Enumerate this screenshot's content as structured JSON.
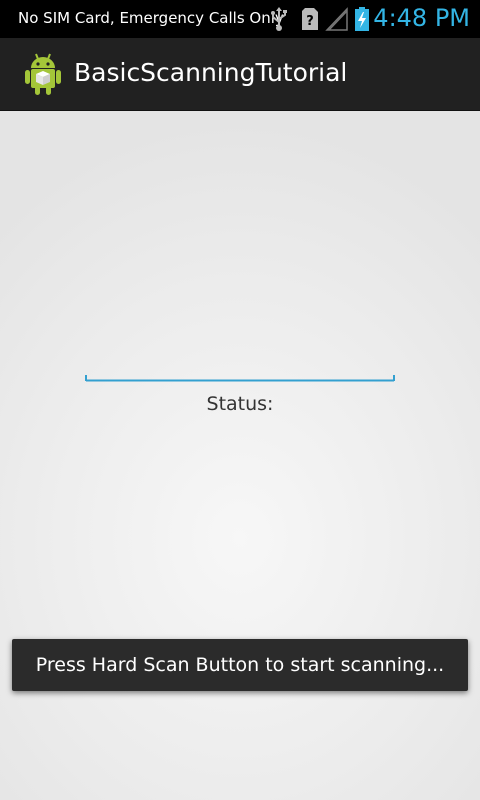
{
  "status_bar": {
    "carrier_text": "No SIM Card, Emergency Calls Only",
    "time": "4:48 PM",
    "icons": [
      "usb-icon",
      "no-sim-icon",
      "signal-icon",
      "battery-charging-icon"
    ],
    "accent_color": "#33b5e5"
  },
  "action_bar": {
    "app_icon": "android-app-icon",
    "title": "BasicScanningTutorial"
  },
  "main": {
    "edit_text_value": "",
    "status_label": "Status:"
  },
  "toast": {
    "message": "Press Hard Scan Button to start scanning..."
  }
}
